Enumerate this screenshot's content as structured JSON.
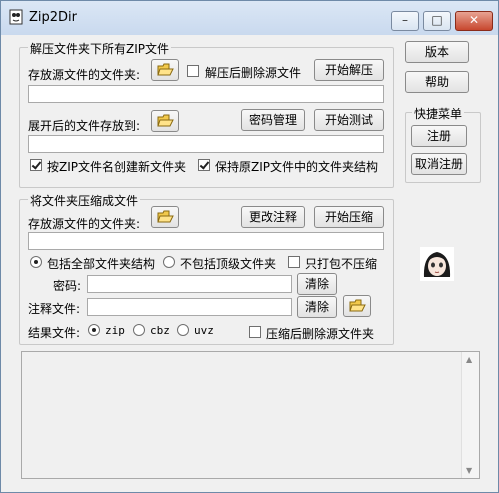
{
  "window": {
    "title": "Zip2Dir",
    "minimize": "–",
    "maximize": "□",
    "close": "✕"
  },
  "extract": {
    "group_title": "解压文件夹下所有ZIP文件",
    "source_label": "存放源文件的文件夹:",
    "delete_after_label": "解压后删除源文件",
    "start_extract": "开始解压",
    "dest_label": "展开后的文件存放到:",
    "password_manage": "密码管理",
    "start_test": "开始测试",
    "opt_create_dir": "按ZIP文件名创建新文件夹",
    "opt_keep_structure": "保持原ZIP文件中的文件夹结构",
    "opt_create_dir_checked": true,
    "opt_keep_structure_checked": true,
    "delete_after_checked": false
  },
  "compress": {
    "group_title": "将文件夹压缩成文件",
    "source_label": "存放源文件的文件夹:",
    "edit_comment": "更改注释",
    "start_compress": "开始压缩",
    "opt_include_all": "包括全部文件夹结构",
    "opt_exclude_top": "不包括顶级文件夹",
    "opt_pack_only": "只打包不压缩",
    "password_label": "密码:",
    "clear": "清除",
    "comment_label": "注释文件:",
    "result_label": "结果文件:",
    "formats": [
      "zip",
      "cbz",
      "uvz"
    ],
    "selected_format": "zip",
    "delete_after_label": "压缩后删除源文件夹"
  },
  "side": {
    "version": "版本",
    "help": "帮助",
    "quick_menu_title": "快捷菜单",
    "register": "注册",
    "unregister": "取消注册"
  }
}
